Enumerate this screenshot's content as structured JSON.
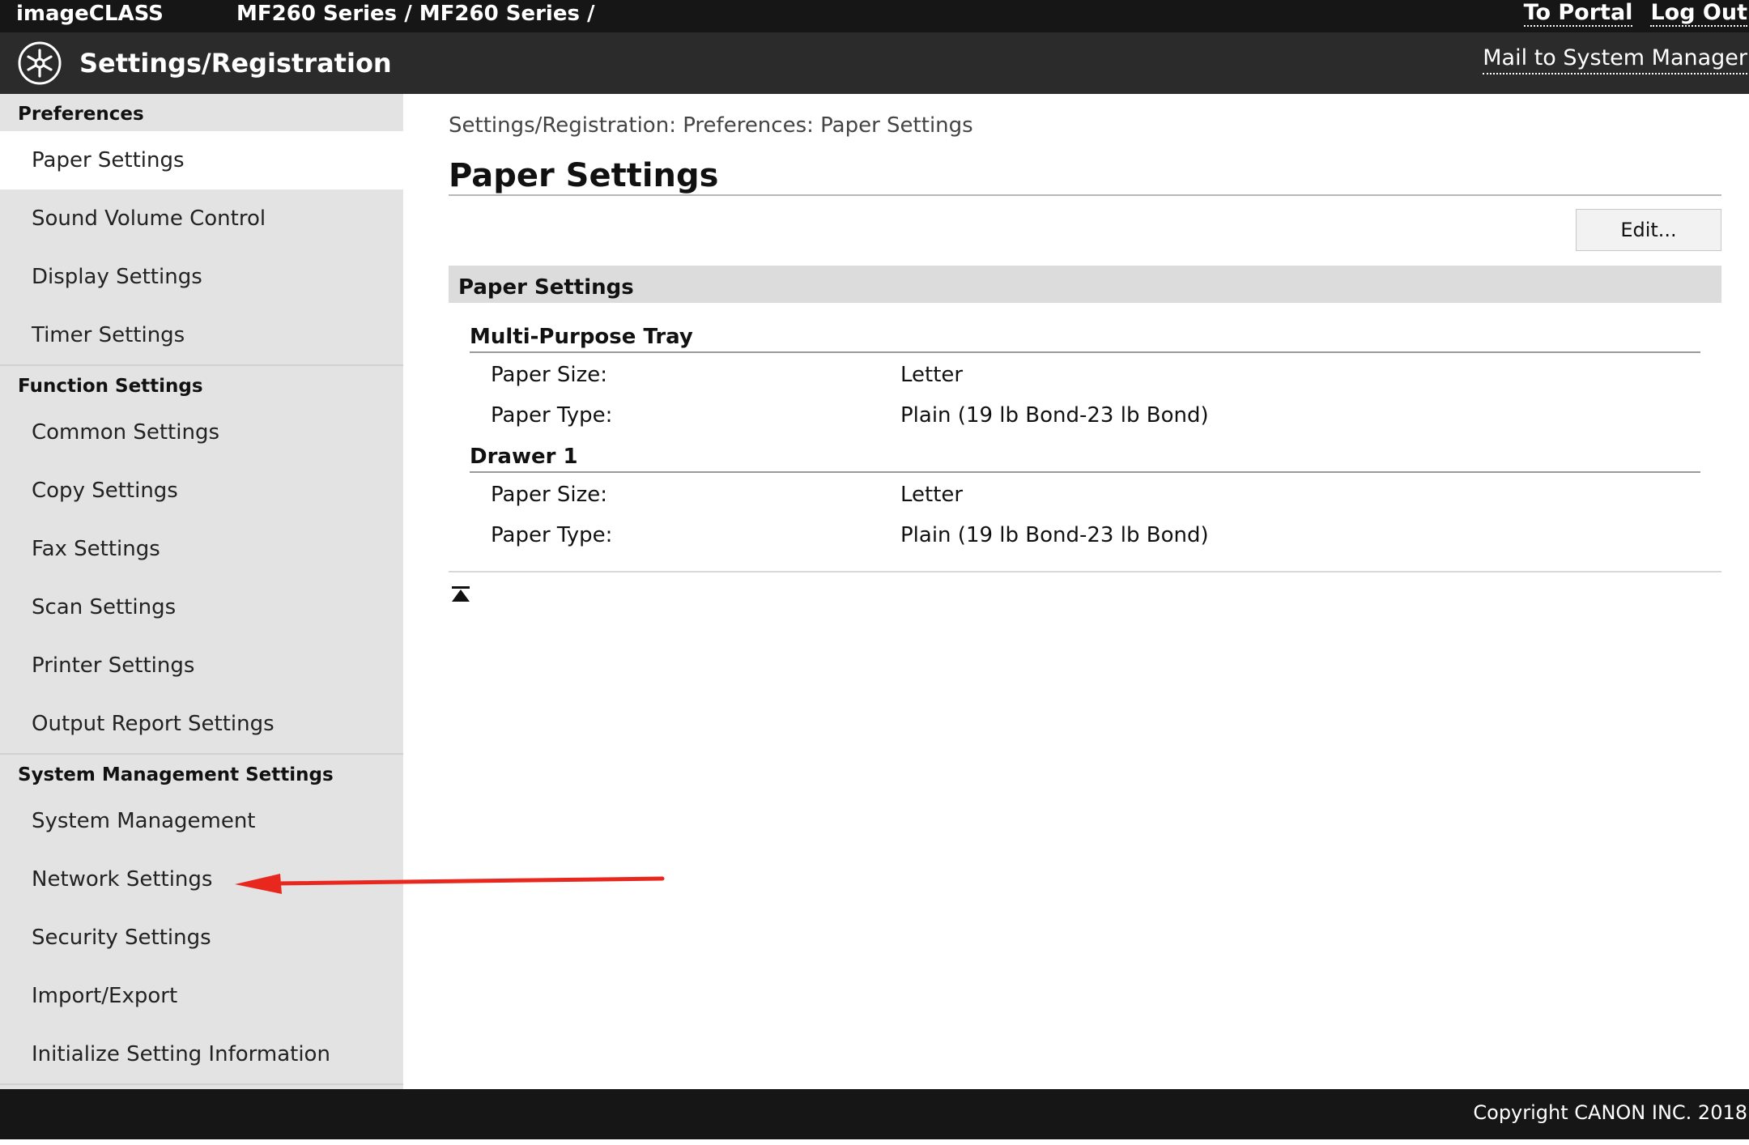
{
  "topbar": {
    "brand": "imageCLASS",
    "device": "MF260 Series / MF260 Series /",
    "to_portal": "To Portal",
    "log_out": "Log Out"
  },
  "header": {
    "title": "Settings/Registration",
    "logo_icon": "settings-registration-icon",
    "mail_link": "Mail to System Manager"
  },
  "sidebar": {
    "preferences_heading": "Preferences",
    "preferences": [
      {
        "label": "Paper Settings",
        "active": true
      },
      {
        "label": "Sound Volume Control"
      },
      {
        "label": "Display Settings"
      },
      {
        "label": "Timer Settings"
      }
    ],
    "function_heading": "Function Settings",
    "function": [
      {
        "label": "Common Settings"
      },
      {
        "label": "Copy Settings"
      },
      {
        "label": "Fax Settings"
      },
      {
        "label": "Scan Settings"
      },
      {
        "label": "Printer Settings"
      },
      {
        "label": "Output Report Settings"
      }
    ],
    "system_heading": "System Management Settings",
    "system": [
      {
        "label": "System Management"
      },
      {
        "label": "Network Settings"
      },
      {
        "label": "Security Settings"
      },
      {
        "label": "Import/Export"
      },
      {
        "label": "Initialize Setting Information"
      }
    ]
  },
  "main": {
    "breadcrumb": "Settings/Registration: Preferences: Paper Settings",
    "title": "Paper Settings",
    "edit_button": "Edit...",
    "section_title": "Paper Settings",
    "groups": [
      {
        "title": "Multi-Purpose Tray",
        "rows": [
          {
            "label": "Paper Size:",
            "value": "Letter"
          },
          {
            "label": "Paper Type:",
            "value": "Plain (19 lb Bond-23 lb Bond)"
          }
        ]
      },
      {
        "title": "Drawer 1",
        "rows": [
          {
            "label": "Paper Size:",
            "value": "Letter"
          },
          {
            "label": "Paper Type:",
            "value": "Plain (19 lb Bond-23 lb Bond)"
          }
        ]
      }
    ],
    "back_to_top_icon": "back-to-top-icon"
  },
  "annotation": {
    "arrow_color": "#e8281e"
  },
  "footer": {
    "copyright": "Copyright CANON INC. 2018"
  }
}
